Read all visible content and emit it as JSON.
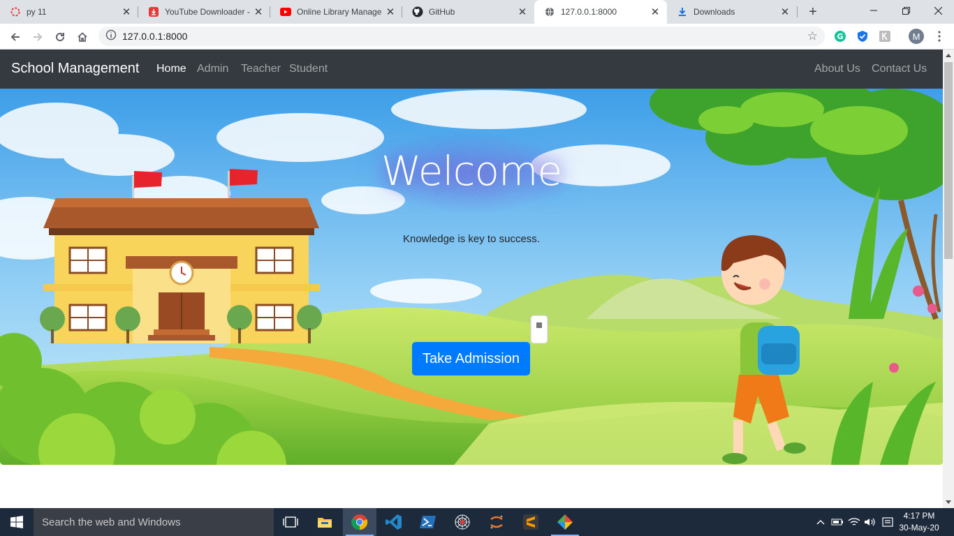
{
  "browser": {
    "tabs": [
      {
        "title": "py 11",
        "active": false
      },
      {
        "title": "YouTube Downloader -",
        "active": false
      },
      {
        "title": "Online Library Manage",
        "active": false
      },
      {
        "title": "GitHub",
        "active": false
      },
      {
        "title": "127.0.0.1:8000",
        "active": true
      },
      {
        "title": "Downloads",
        "active": false
      }
    ],
    "url": "127.0.0.1:8000",
    "profile_initial": "M"
  },
  "navbar": {
    "brand": "School Management",
    "links": [
      "Home",
      "Admin",
      "Teacher",
      "Student"
    ],
    "right_links": [
      "About Us",
      "Contact Us"
    ],
    "active": "Home"
  },
  "hero": {
    "title": "Welcome",
    "subtitle": "Knowledge is key to success.",
    "button": "Take Admission"
  },
  "taskbar": {
    "search_placeholder": "Search the web and Windows",
    "time": "4:17 PM",
    "date": "30-May-20"
  },
  "colors": {
    "navbar_bg": "#343a40",
    "primary_button": "#007bff",
    "taskbar_bg": "#1c2a3b"
  }
}
